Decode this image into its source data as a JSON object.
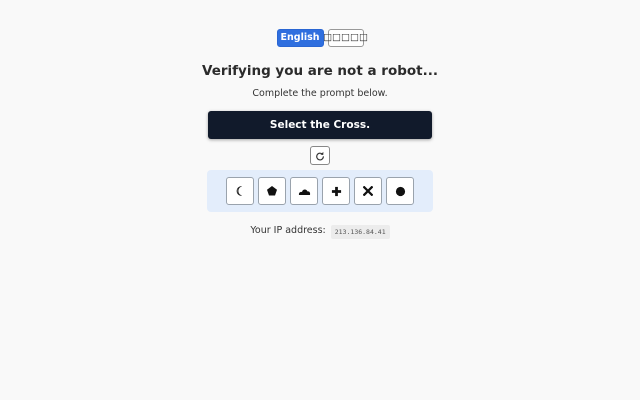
{
  "languages": [
    {
      "label": "English",
      "active": true
    },
    {
      "label": "□□□□□",
      "active": false
    }
  ],
  "title": "Verifying you are not a robot...",
  "subtitle": "Complete the prompt below.",
  "prompt": "Select the Cross.",
  "refresh_icon": "refresh-icon",
  "choices": [
    {
      "icon": "crescent-moon-icon"
    },
    {
      "icon": "pentagon-icon"
    },
    {
      "icon": "cloud-icon"
    },
    {
      "icon": "plus-cross-icon"
    },
    {
      "icon": "x-cross-icon"
    },
    {
      "icon": "circle-icon"
    }
  ],
  "ip": {
    "label": "Your IP address:",
    "value": "213.136.84.41"
  },
  "colors": {
    "accent": "#2f6fdf",
    "prompt_bg": "#111a2b",
    "panel_bg": "#e3edfb",
    "page_bg": "#f9f9f9"
  }
}
